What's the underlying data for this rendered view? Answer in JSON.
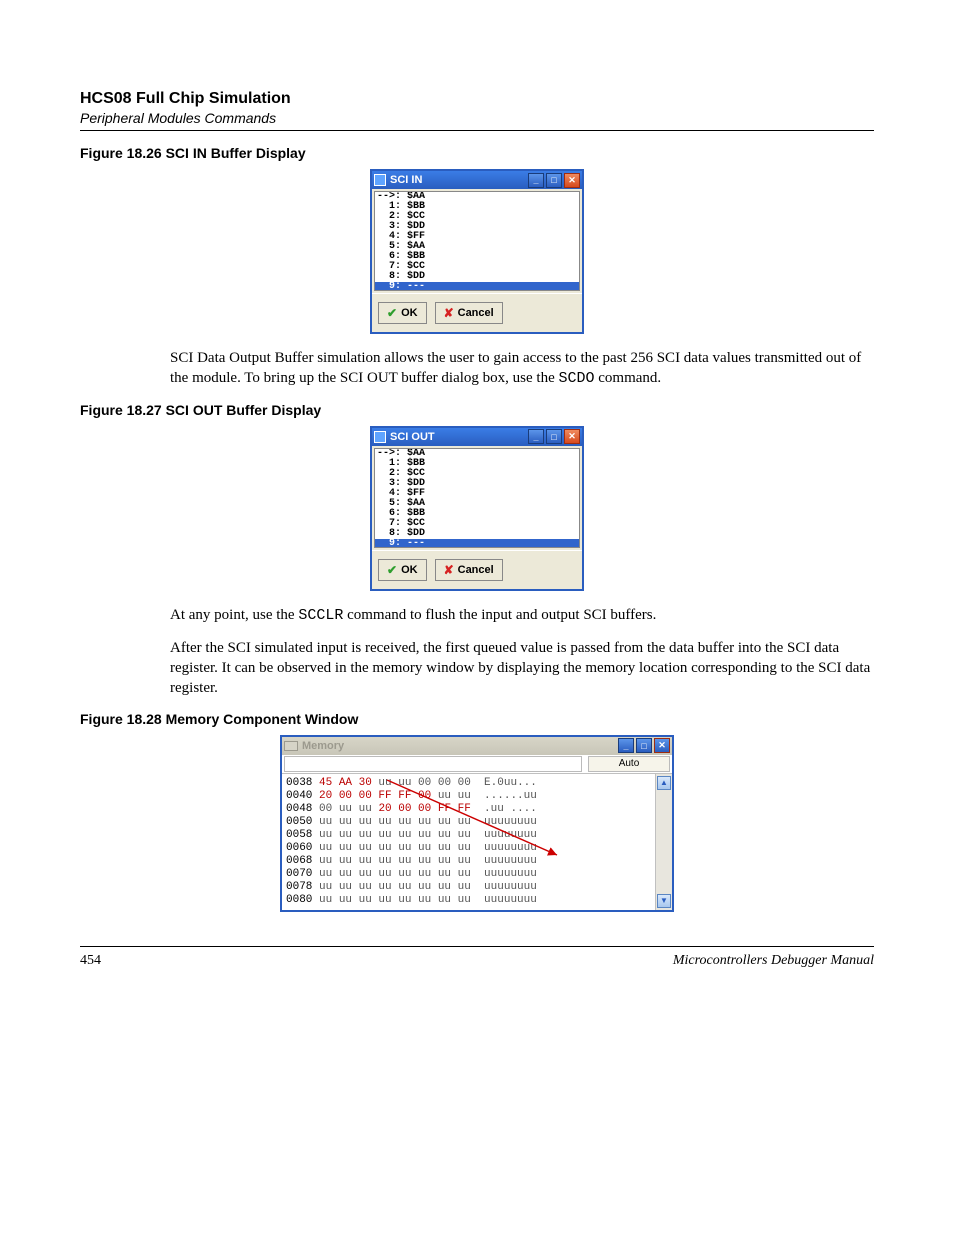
{
  "header": {
    "title": "HCS08 Full Chip Simulation",
    "subtitle": "Peripheral Modules Commands"
  },
  "fig26": {
    "caption": "Figure 18.26  SCI IN Buffer Display",
    "win_title": "SCI IN",
    "rows": [
      "-->: $AA",
      "  1: $BB",
      "  2: $CC",
      "  3: $DD",
      "  4: $FF",
      "  5: $AA",
      "  6: $BB",
      "  7: $CC",
      "  8: $DD"
    ],
    "sel_row": "  9: ---",
    "ok": "OK",
    "cancel": "Cancel"
  },
  "para1a": "SCI Data Output Buffer simulation allows the user to gain access to the past 256 SCI data values transmitted out of the module. To bring up the SCI OUT buffer dialog box, use the ",
  "para1_cmd": "SCDO",
  "para1b": " command.",
  "fig27": {
    "caption": "Figure 18.27  SCI OUT Buffer Display",
    "win_title": "SCI OUT",
    "rows": [
      "-->: $AA",
      "  1: $BB",
      "  2: $CC",
      "  3: $DD",
      "  4: $FF",
      "  5: $AA",
      "  6: $BB",
      "  7: $CC",
      "  8: $DD"
    ],
    "sel_row": "  9: ---",
    "ok": "OK",
    "cancel": "Cancel"
  },
  "para2a": "At any point, use the ",
  "para2_cmd": "SCCLR",
  "para2b": " command to flush the input and output SCI buffers.",
  "para3": "After the SCI simulated input is received, the first queued value is passed from the data buffer into the SCI data register. It can be observed in the memory window by displaying the memory location corresponding to the SCI data register.",
  "fig28": {
    "caption": "Figure 18.28  Memory Component Window",
    "win_title": "Memory",
    "auto": "Auto",
    "rows": [
      {
        "addr": "0038",
        "hi": "45 AA 30",
        "mid": " uu uu ",
        "plain": "00 00 00",
        "ascii": "  E.0uu..."
      },
      {
        "addr": "0040",
        "hi": "20 00 00 FF FF 00",
        "mid": "",
        "plain": " uu uu",
        "ascii": "  ......uu"
      },
      {
        "addr": "0048",
        "hi": "",
        "mid": "00 uu uu ",
        "plain2": "20 00 00 FF FF",
        "ascii": "  .uu ...."
      },
      {
        "addr": "0050",
        "hi": "",
        "mid": "uu uu uu uu uu uu uu uu",
        "plain": "",
        "ascii": "  uuuuuuuu"
      },
      {
        "addr": "0058",
        "hi": "",
        "mid": "uu uu uu uu uu uu uu uu",
        "plain": "",
        "ascii": "  uuuuuuuu"
      },
      {
        "addr": "0060",
        "hi": "",
        "mid": "uu uu uu uu uu uu uu uu",
        "plain": "",
        "ascii": "  uuuuuuuu"
      },
      {
        "addr": "0068",
        "hi": "",
        "mid": "uu uu uu uu uu uu uu uu",
        "plain": "",
        "ascii": "  uuuuuuuu"
      },
      {
        "addr": "0070",
        "hi": "",
        "mid": "uu uu uu uu uu uu uu uu",
        "plain": "",
        "ascii": "  uuuuuuuu"
      },
      {
        "addr": "0078",
        "hi": "",
        "mid": "uu uu uu uu uu uu uu uu",
        "plain": "",
        "ascii": "  uuuuuuuu"
      },
      {
        "addr": "0080",
        "hi": "",
        "mid": "uu uu uu uu uu uu uu uu",
        "plain": "",
        "ascii": "  uuuuuuuu"
      }
    ]
  },
  "footer": {
    "page": "454",
    "manual": "Microcontrollers Debugger Manual"
  }
}
